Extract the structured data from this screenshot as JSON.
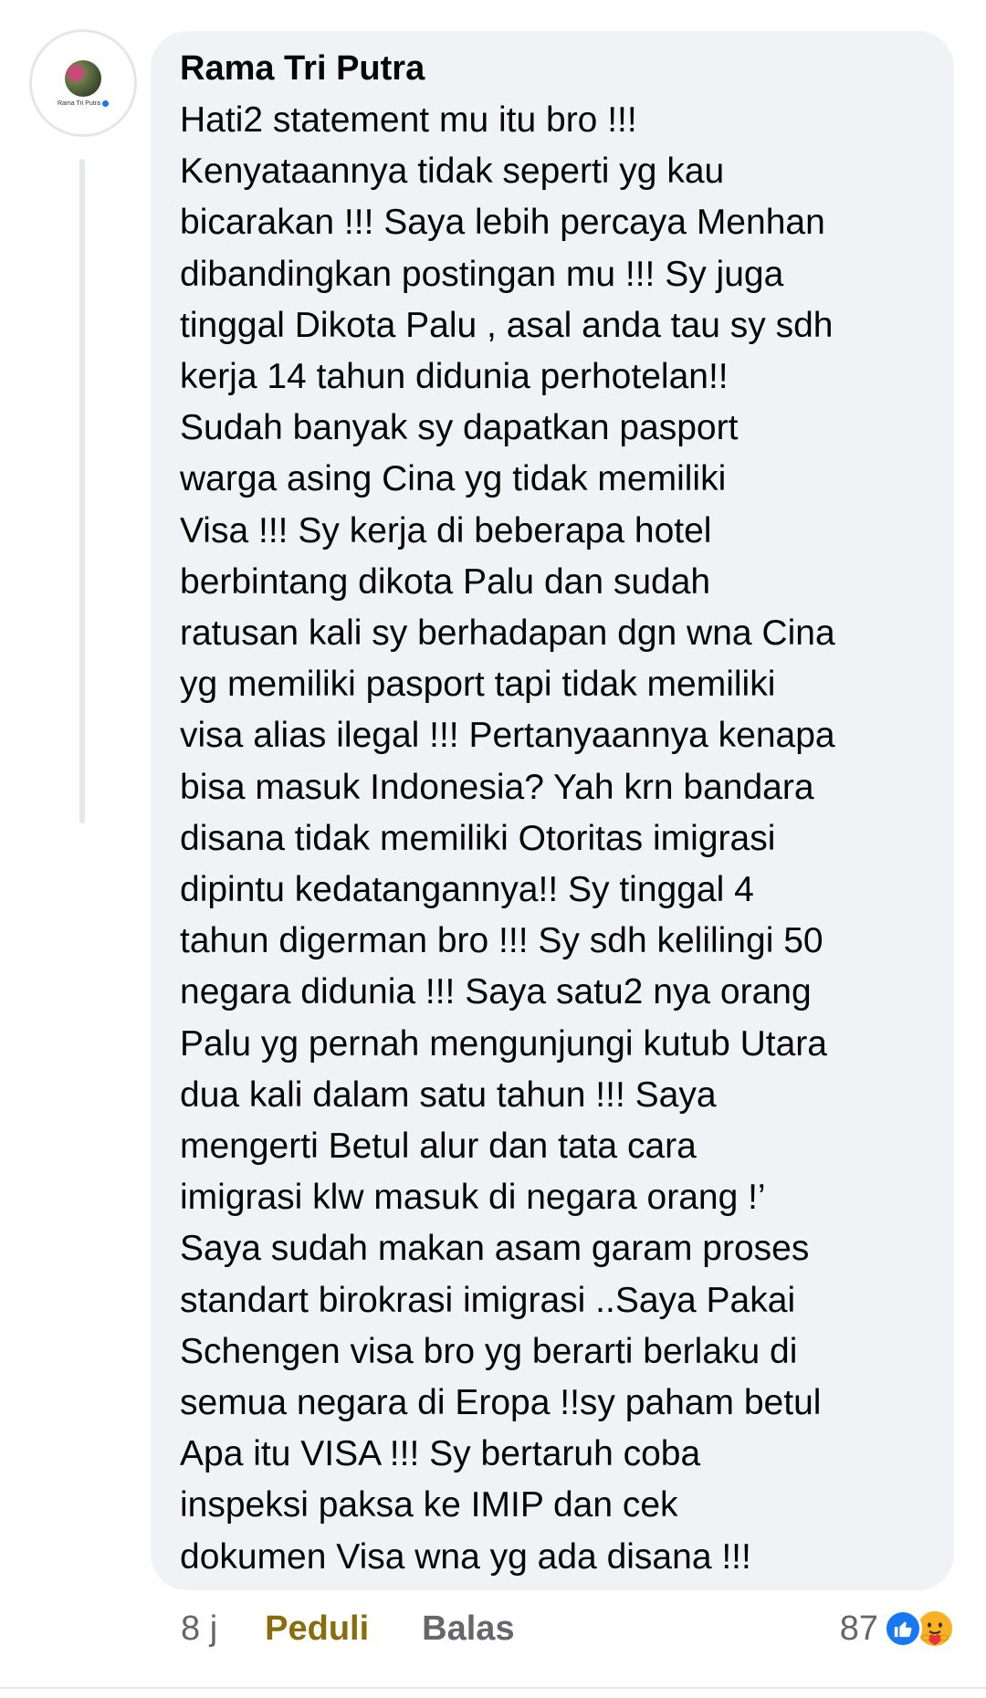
{
  "comment": {
    "avatar_caption": "Rama Tri Putra",
    "author": "Rama Tri Putra",
    "lines": [
      "Hati2 statement mu itu bro !!!",
      "Kenyataannya tidak seperti yg kau",
      "bicarakan !!! Saya lebih percaya Menhan",
      "dibandingkan postingan mu !!! Sy juga",
      "tinggal Dikota Palu , asal anda tau sy sdh",
      "kerja 14 tahun didunia perhotelan!!",
      "Sudah banyak sy dapatkan pasport",
      "warga asing Cina yg tidak memiliki",
      "Visa !!! Sy kerja di beberapa hotel",
      "berbintang dikota Palu dan sudah",
      "ratusan kali sy berhadapan dgn wna Cina",
      "yg memiliki pasport tapi tidak memiliki",
      "visa alias ilegal !!! Pertanyaannya kenapa",
      "bisa masuk Indonesia? Yah krn bandara",
      "disana tidak memiliki Otoritas imigrasi",
      "dipintu kedatangannya!! Sy tinggal 4",
      "tahun digerman bro !!! Sy sdh kelilingi 50",
      "negara didunia !!! Saya satu2 nya orang",
      "Palu yg pernah mengunjungi kutub Utara",
      "dua kali dalam satu tahun !!! Saya",
      "mengerti Betul alur dan tata cara",
      "imigrasi klw masuk di negara orang !’",
      "Saya sudah makan asam garam proses",
      "standart birokrasi imigrasi ..Saya Pakai",
      "Schengen visa bro yg berarti berlaku di",
      "semua negara di Eropa !!sy paham betul",
      "Apa itu VISA !!! Sy bertaruh coba",
      "inspeksi paksa ke IMIP dan cek",
      "dokumen Visa wna yg ada disana !!!"
    ]
  },
  "actions": {
    "time": "8 j",
    "care_label": "Peduli",
    "reply_label": "Balas"
  },
  "reactions": {
    "count": "87",
    "icons": [
      "like-icon",
      "care-icon"
    ]
  },
  "colors": {
    "bubble": "#f0f2f5",
    "care_text": "#8a6d0b",
    "secondary_text": "#65676b",
    "like_blue": "#1877f2",
    "care_yellow": "#f7b125"
  }
}
